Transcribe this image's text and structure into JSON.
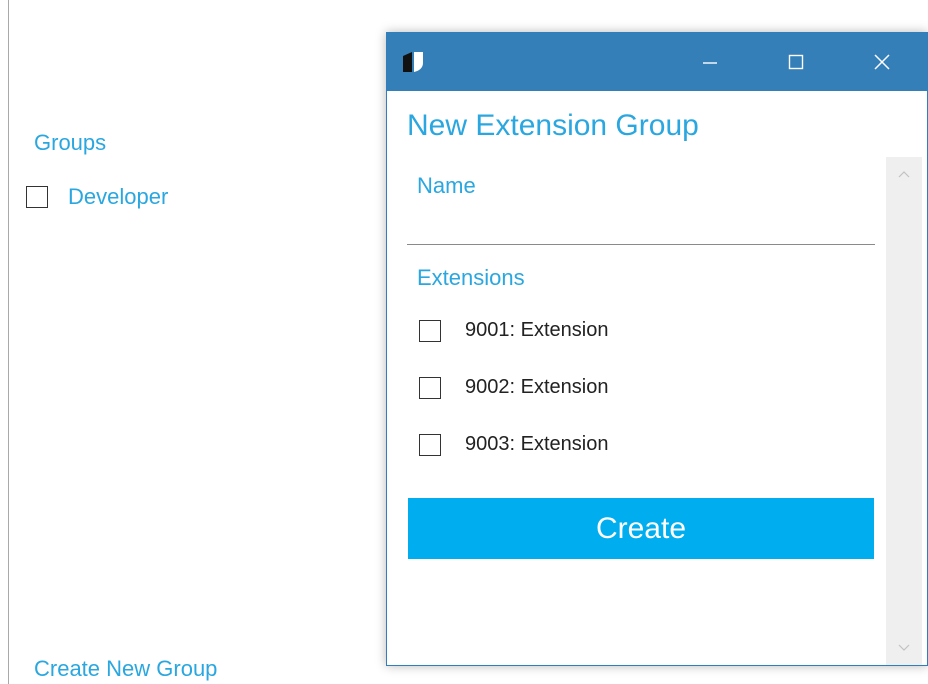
{
  "left_panel": {
    "groups_title": "Groups",
    "groups": [
      {
        "label": "Developer",
        "checked": false
      }
    ],
    "create_new_group": "Create New Group"
  },
  "dialog": {
    "title": "New Extension Group",
    "name_label": "Name",
    "name_value": "",
    "extensions_label": "Extensions",
    "extensions": [
      {
        "label": "9001: Extension",
        "checked": false
      },
      {
        "label": "9002: Extension",
        "checked": false
      },
      {
        "label": "9003: Extension",
        "checked": false
      }
    ],
    "create_button": "Create",
    "titlebar_icons": [
      "app-logo-icon",
      "minimize-icon",
      "maximize-icon",
      "close-icon"
    ]
  },
  "colors": {
    "accent": "#2aa7e0",
    "titlebar": "#347fb8",
    "create_button": "#00aeef"
  }
}
